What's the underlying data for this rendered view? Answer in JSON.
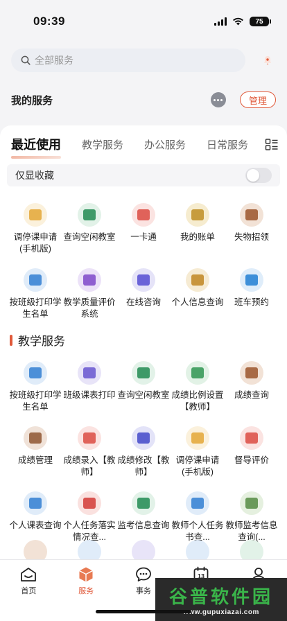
{
  "status_bar": {
    "time": "09:39",
    "battery": "75"
  },
  "search": {
    "placeholder": "全部服务"
  },
  "my_services": {
    "title": "我的服务",
    "manage_label": "管理"
  },
  "tabs": [
    {
      "label": "最近使用",
      "active": true
    },
    {
      "label": "教学服务",
      "active": false
    },
    {
      "label": "办公服务",
      "active": false
    },
    {
      "label": "日常服务",
      "active": false
    }
  ],
  "favorites_filter": {
    "label": "仅显收藏",
    "enabled": false
  },
  "recent_services": [
    {
      "label": "调停课申请(手机版)",
      "icon": "notepad-icon",
      "color": "#e7b24f",
      "bg": "#fbf1dc"
    },
    {
      "label": "查询空闲教室",
      "icon": "classroom-board-icon",
      "color": "#3e9a68",
      "bg": "#e2f2e8"
    },
    {
      "label": "一卡通",
      "icon": "card-icon",
      "color": "#e0625a",
      "bg": "#fbe3e1"
    },
    {
      "label": "我的账单",
      "icon": "bill-icon",
      "color": "#c79c3d",
      "bg": "#f6eccf"
    },
    {
      "label": "失物招领",
      "icon": "box-icon",
      "color": "#a86a45",
      "bg": "#f2e2d6"
    },
    {
      "label": "按班级打印学生名单",
      "icon": "printer-icon",
      "color": "#4c8fd8",
      "bg": "#e0ecf9"
    },
    {
      "label": "教学质量评价系统",
      "icon": "presentation-icon",
      "color": "#8f5fd0",
      "bg": "#ece2f8"
    },
    {
      "label": "在线咨询",
      "icon": "consult-icon",
      "color": "#6a63d8",
      "bg": "#e5e3f8"
    },
    {
      "label": "个人信息查询",
      "icon": "id-card-icon",
      "color": "#c8953c",
      "bg": "#f6ebd3"
    },
    {
      "label": "班车预约",
      "icon": "bus-icon",
      "color": "#3d8fd9",
      "bg": "#dfedfa"
    }
  ],
  "teaching_section": {
    "title": "教学服务"
  },
  "teaching_services": [
    {
      "label": "按班级打印学生名单",
      "icon": "printer-icon",
      "color": "#4c8fd8",
      "bg": "#e0ecf9"
    },
    {
      "label": "班级课表打印",
      "icon": "timetable-icon",
      "color": "#7b6bd6",
      "bg": "#e8e4f8"
    },
    {
      "label": "查询空闲教室",
      "icon": "classroom-board-icon",
      "color": "#3e9a68",
      "bg": "#e2f2e8"
    },
    {
      "label": "成绩比例设置【教师】",
      "icon": "grade-ratio-icon",
      "color": "#4aa368",
      "bg": "#e2f2e6"
    },
    {
      "label": "成绩查询",
      "icon": "calendar-icon",
      "color": "#a86a45",
      "bg": "#f2e2d6"
    },
    {
      "label": "成绩管理",
      "icon": "ledger-icon",
      "color": "#9d6a4a",
      "bg": "#f0e2d8"
    },
    {
      "label": "成绩录入【教师】",
      "icon": "grade-entry-icon",
      "color": "#e0625a",
      "bg": "#fbe3e1"
    },
    {
      "label": "成绩修改【教师】",
      "icon": "grade-edit-icon",
      "color": "#5a5fd0",
      "bg": "#e3e3f8"
    },
    {
      "label": "调停课申请(手机版)",
      "icon": "notepad-icon",
      "color": "#e7b24f",
      "bg": "#fbf1dc"
    },
    {
      "label": "督导评价",
      "icon": "supervise-icon",
      "color": "#e0625a",
      "bg": "#fbe3e1"
    },
    {
      "label": "个人课表查询",
      "icon": "schedule-grid-icon",
      "color": "#4c8fd8",
      "bg": "#e0ecf9"
    },
    {
      "label": "个人任务落实情况查...",
      "icon": "task-book-icon",
      "color": "#d9534f",
      "bg": "#fae1df"
    },
    {
      "label": "监考信息查询",
      "icon": "invigilate-icon",
      "color": "#3e9a68",
      "bg": "#e2f2e8"
    },
    {
      "label": "教师个人任务书查...",
      "icon": "task-doc-icon",
      "color": "#4c8fd8",
      "bg": "#e0ecf9"
    },
    {
      "label": "教师监考信息查询(...",
      "icon": "teacher-invigilate-icon",
      "color": "#6a9a5a",
      "bg": "#e5f0df"
    }
  ],
  "partial_row_colors": [
    "#f2e2d6",
    "#e0ecf9",
    "#e8e4f8",
    "#e0ecf9",
    "#e2f2e8"
  ],
  "tabbar": [
    {
      "label": "首页",
      "icon": "home-icon",
      "active": false
    },
    {
      "label": "服务",
      "icon": "services-cube-icon",
      "active": true
    },
    {
      "label": "事务",
      "icon": "chat-bubble-icon",
      "active": false
    },
    {
      "label": "13",
      "icon": "calendar-day-icon",
      "active": false
    },
    {
      "label": "",
      "icon": "profile-icon",
      "active": false
    }
  ],
  "watermark": {
    "title": "谷普软件园",
    "url": "www.gupuxiazai.com"
  },
  "colors": {
    "accent": "#e0593a"
  }
}
